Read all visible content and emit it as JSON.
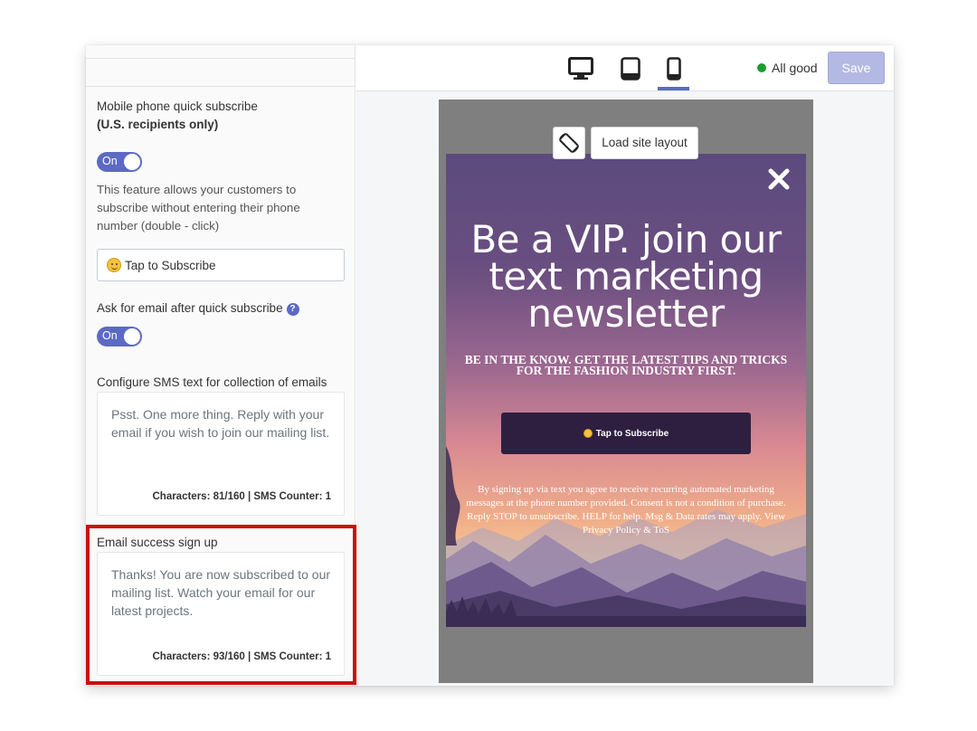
{
  "sidebar": {
    "quick_subscribe_title": "Mobile phone quick subscribe",
    "quick_subscribe_subtitle": "(U.S. recipients only)",
    "quick_subscribe_toggle": "On",
    "quick_subscribe_desc": "This feature allows your customers to subscribe without entering their phone number (double - click)",
    "button_text_value": "Tap to Subscribe",
    "ask_email_label": "Ask for email after quick subscribe",
    "ask_email_toggle": "On",
    "sms_email_label": "Configure SMS text for collection of emails",
    "sms_email_text": "Psst. One more thing. Reply with your email if you wish to join our mailing list.",
    "sms_email_counter": "Characters: 81/160 | SMS Counter: 1",
    "success_label": "Email success sign up",
    "success_text": "Thanks! You are now subscribed to our mailing list. Watch your email for our latest projects.",
    "success_counter": "Characters: 93/160 | SMS Counter: 1"
  },
  "toolbar": {
    "devices": [
      "desktop",
      "tablet",
      "mobile"
    ],
    "active_device": "mobile",
    "status": "All good",
    "save_label": "Save"
  },
  "preview": {
    "load_site_layout": "Load site layout",
    "headline": "Be a VIP. join our text marketing newsletter",
    "subheadline": "BE IN THE KNOW. GET THE LATEST TIPS AND TRICKS FOR THE FASHION INDUSTRY FIRST.",
    "cta": "Tap to Subscribe",
    "legal": "By signing up via text you agree to receive recurring automated marketing messages at the phone number provided. Consent is not a condition of purchase. Reply STOP to unsubscribe. HELP for help. Msg & Data rates may apply. View Privacy Policy & ToS"
  },
  "colors": {
    "accent": "#5c6ac4",
    "highlight": "#cc0e0e",
    "status_ok": "#1b9e2f",
    "cta_bg": "#2e1f40"
  }
}
